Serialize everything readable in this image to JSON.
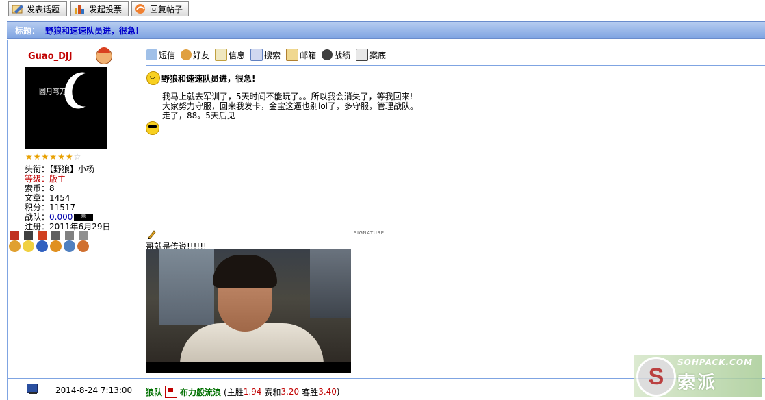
{
  "toolbar": {
    "new_topic": "发表话题",
    "new_poll": "发起投票",
    "reply": "回复帖子"
  },
  "thread": {
    "title_label": "标题：",
    "title": "野狼和速速队员进，很急!"
  },
  "user": {
    "name": "Guao_DJJ",
    "avatar_caption": "圆月弯刀",
    "stars_filled": 6,
    "stars_total": 7,
    "title_label": "头衔：",
    "title_value": "【野狼】小杨",
    "level_label": "等级：",
    "level_value": "版主",
    "coins_label": "索币：",
    "coins_value": "8",
    "posts_label": "文章：",
    "posts_value": "1454",
    "points_label": "积分：",
    "points_value": "11517",
    "team_label": "战队：",
    "team_value": "0.000",
    "joined_label": "注册：",
    "joined_value": "2011年6月29日"
  },
  "post_tools": [
    "短信",
    "好友",
    "信息",
    "搜索",
    "邮箱",
    "战绩",
    "案底"
  ],
  "post": {
    "title": "野狼和速速队员进，很急!",
    "lines": [
      "我马上就去军训了，5天时间不能玩了。。所以我会消失了，等我回来!",
      "大家努力守服，回来我发卡，金宝这逼也别lol了，多守服，管理战队。",
      "走了，88。5天后见"
    ]
  },
  "signature": {
    "label": "SIGNATURE",
    "text": "哥就是传说!!!!!!"
  },
  "footer": {
    "date": "2014-8-24 7:13:00",
    "team1": "狼队",
    "team2": "布力般流浪",
    "stats_prefix": "(主胜",
    "home_win": "1.94",
    "draw_label": "赛和",
    "draw": "3.20",
    "away_label": "客胜",
    "away_win": "3.40",
    "stats_suffix": ")"
  },
  "watermark": {
    "url": "SOHPACK.COM",
    "brand": "索派"
  },
  "colors": {
    "titlebar": "#7fa4e2",
    "username": "#c00000",
    "title_text": "#0000cc",
    "team_green": "#007000",
    "odds_red": "#c00000"
  }
}
